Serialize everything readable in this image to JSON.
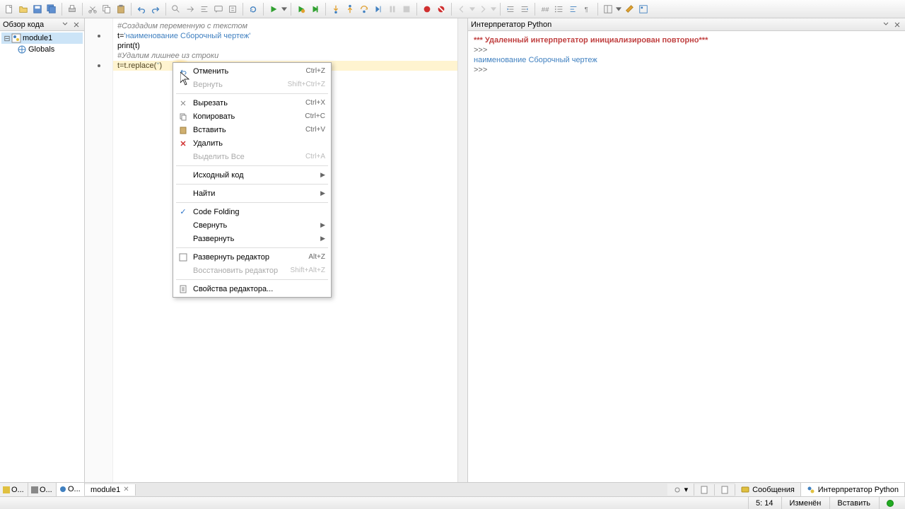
{
  "left_panel": {
    "title": "Обзор кода",
    "tree": {
      "module": "module1",
      "globals": "Globals"
    },
    "tabs": [
      "О...",
      "О...",
      "О..."
    ]
  },
  "code": {
    "l1": "#Создадим переменную с текстом",
    "l2a": "t=",
    "l2b": "'наименование Сборочный чертеж'",
    "l3": "print(t)",
    "l4": "#Удалим лишнее из строки",
    "l5a": "t=t.replace(",
    "l5b": "''",
    "l5c": ")"
  },
  "editor_tab": "module1",
  "interpreter": {
    "title": "Интерпретатор Python",
    "l1": "*** Удаленный интерпретатор инициализирован повторно***",
    "l2": ">>> ",
    "l3": "наименование Сборочный чертеж",
    "l4": ">>> "
  },
  "bottom_tabs": {
    "messages": "Сообщения",
    "interpreter": "Интерпретатор Python"
  },
  "status": {
    "pos": "5: 14",
    "modified": "Изменён",
    "insert": "Вставить"
  },
  "context_menu": {
    "undo": {
      "label": "Отменить",
      "shortcut": "Ctrl+Z"
    },
    "redo": {
      "label": "Вернуть",
      "shortcut": "Shift+Ctrl+Z"
    },
    "cut": {
      "label": "Вырезать",
      "shortcut": "Ctrl+X"
    },
    "copy": {
      "label": "Копировать",
      "shortcut": "Ctrl+C"
    },
    "paste": {
      "label": "Вставить",
      "shortcut": "Ctrl+V"
    },
    "delete": {
      "label": "Удалить"
    },
    "select_all": {
      "label": "Выделить Все",
      "shortcut": "Ctrl+A"
    },
    "source": {
      "label": "Исходный код"
    },
    "find": {
      "label": "Найти"
    },
    "code_folding": {
      "label": "Code Folding"
    },
    "collapse": {
      "label": "Свернуть"
    },
    "expand": {
      "label": "Развернуть"
    },
    "expand_editor": {
      "label": "Развернуть редактор",
      "shortcut": "Alt+Z"
    },
    "restore_editor": {
      "label": "Восстановить редактор",
      "shortcut": "Shift+Alt+Z"
    },
    "editor_props": {
      "label": "Свойства редактора..."
    }
  }
}
